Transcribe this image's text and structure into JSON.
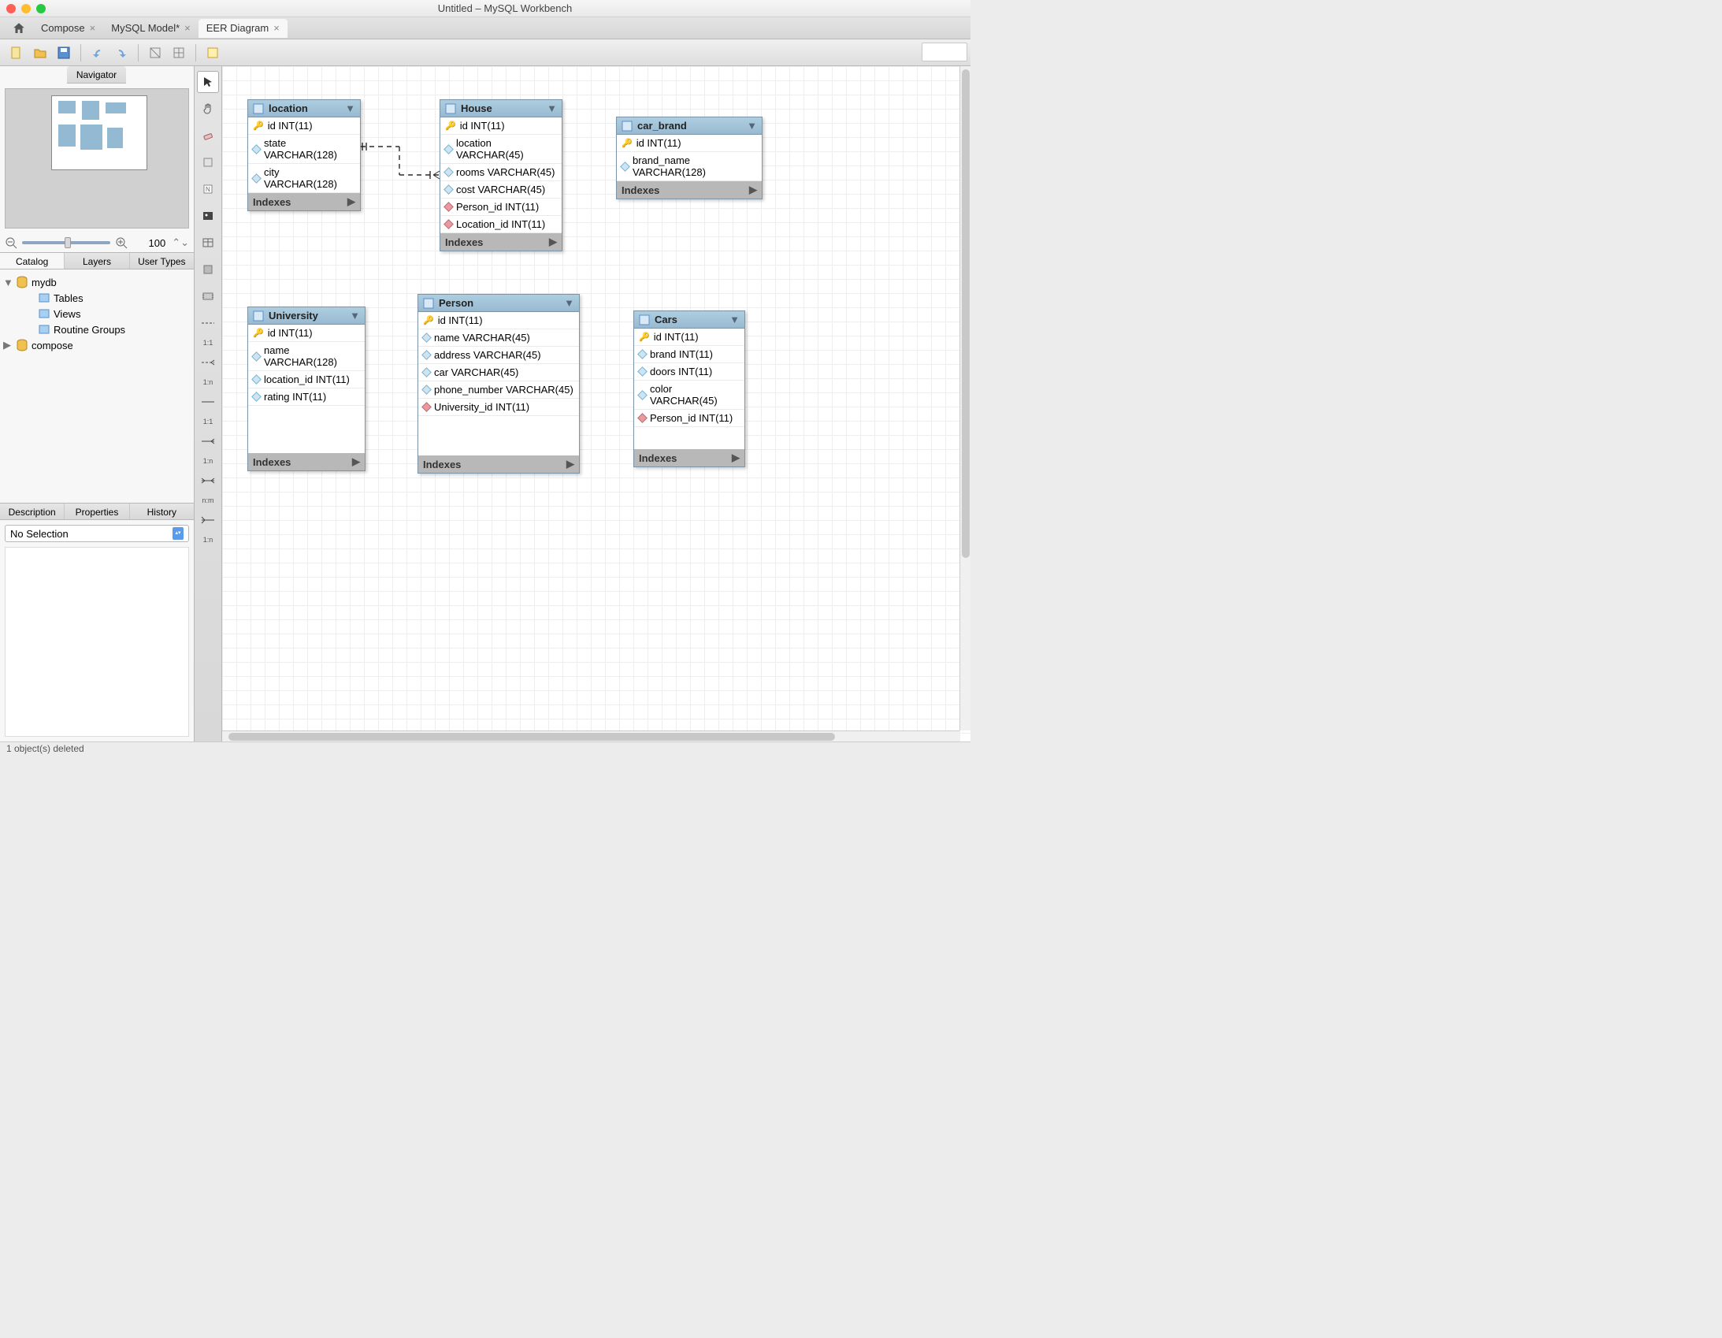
{
  "window_title": "Untitled – MySQL Workbench",
  "tabs": [
    {
      "label": "Compose"
    },
    {
      "label": "MySQL Model*"
    },
    {
      "label": "EER Diagram"
    }
  ],
  "navigator_label": "Navigator",
  "zoom_value": "100",
  "side_tabs": [
    "Catalog",
    "Layers",
    "User Types"
  ],
  "catalog": {
    "db1": {
      "name": "mydb",
      "children": [
        "Tables",
        "Views",
        "Routine Groups"
      ]
    },
    "db2": {
      "name": "compose"
    }
  },
  "side_tabs2": [
    "Description",
    "Properties",
    "History"
  ],
  "desc_selection": "No Selection",
  "statusbar": "1 object(s) deleted",
  "indexes_label": "Indexes",
  "rel_labels": [
    "1:1",
    "1:n",
    "1:1",
    "1:n",
    "n:m",
    "1:n"
  ],
  "entities": {
    "location": {
      "title": "location",
      "cols": [
        {
          "k": "pk",
          "t": "id INT(11)"
        },
        {
          "k": "c",
          "t": "state VARCHAR(128)"
        },
        {
          "k": "c",
          "t": "city VARCHAR(128)"
        }
      ]
    },
    "house": {
      "title": "House",
      "cols": [
        {
          "k": "pk",
          "t": "id INT(11)"
        },
        {
          "k": "c",
          "t": "location VARCHAR(45)"
        },
        {
          "k": "c",
          "t": "rooms VARCHAR(45)"
        },
        {
          "k": "c",
          "t": "cost VARCHAR(45)"
        },
        {
          "k": "fk",
          "t": "Person_id INT(11)"
        },
        {
          "k": "fk",
          "t": "Location_id INT(11)"
        }
      ]
    },
    "car_brand": {
      "title": "car_brand",
      "cols": [
        {
          "k": "pk",
          "t": "id INT(11)"
        },
        {
          "k": "c",
          "t": "brand_name VARCHAR(128)"
        }
      ]
    },
    "university": {
      "title": "University",
      "cols": [
        {
          "k": "pk",
          "t": "id INT(11)"
        },
        {
          "k": "c",
          "t": "name VARCHAR(128)"
        },
        {
          "k": "c",
          "t": "location_id INT(11)"
        },
        {
          "k": "c",
          "t": "rating INT(11)"
        }
      ]
    },
    "person": {
      "title": "Person",
      "cols": [
        {
          "k": "pk",
          "t": "id INT(11)"
        },
        {
          "k": "c",
          "t": "name VARCHAR(45)"
        },
        {
          "k": "c",
          "t": "address VARCHAR(45)"
        },
        {
          "k": "c",
          "t": "car VARCHAR(45)"
        },
        {
          "k": "c",
          "t": "phone_number VARCHAR(45)"
        },
        {
          "k": "fk",
          "t": "University_id INT(11)"
        }
      ]
    },
    "cars": {
      "title": "Cars",
      "cols": [
        {
          "k": "pk",
          "t": "id INT(11)"
        },
        {
          "k": "c",
          "t": "brand INT(11)"
        },
        {
          "k": "c",
          "t": "doors INT(11)"
        },
        {
          "k": "c",
          "t": "color VARCHAR(45)"
        },
        {
          "k": "fk",
          "t": "Person_id INT(11)"
        }
      ]
    }
  }
}
